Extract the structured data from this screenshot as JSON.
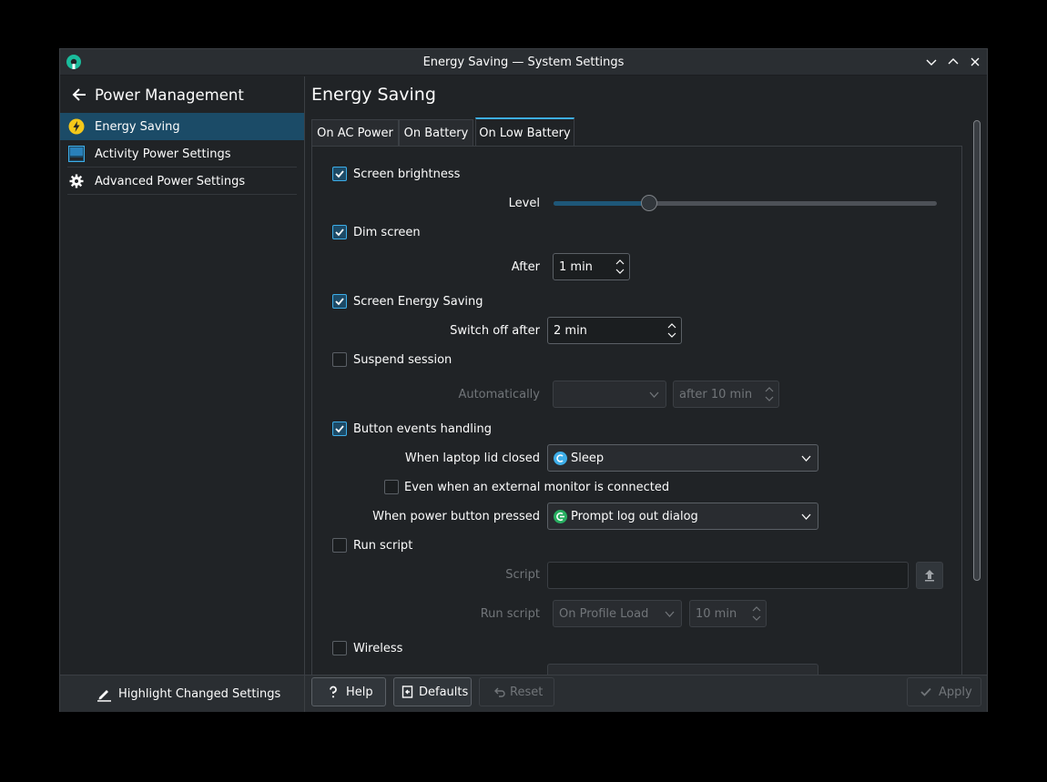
{
  "window": {
    "title": "Energy Saving — System Settings",
    "app_icon": "system-settings-icon",
    "controls": [
      "minimize-icon",
      "maximize-icon",
      "close-icon"
    ]
  },
  "sidebar": {
    "back_icon": "arrow-left-icon",
    "title": "Power Management",
    "items": [
      {
        "label": "Energy Saving",
        "icon": "lightning-icon",
        "active": true
      },
      {
        "label": "Activity Power Settings",
        "icon": "activity-icon",
        "active": false
      },
      {
        "label": "Advanced Power Settings",
        "icon": "gear-icon",
        "active": false
      }
    ],
    "footer": {
      "label": "Highlight Changed Settings",
      "icon": "pencil-icon"
    }
  },
  "main": {
    "title": "Energy Saving",
    "tabs": [
      {
        "label": "On AC Power",
        "active": false
      },
      {
        "label": "On Battery",
        "active": false
      },
      {
        "label": "On Low Battery",
        "active": true
      }
    ]
  },
  "settings": {
    "screen_brightness": {
      "label": "Screen brightness",
      "checked": true,
      "level_label": "Level",
      "level_fraction": 0.25
    },
    "dim_screen": {
      "label": "Dim screen",
      "checked": true,
      "after_label": "After",
      "after_value": "1 min"
    },
    "screen_energy_saving": {
      "label": "Screen Energy Saving",
      "checked": true,
      "switch_off_label": "Switch off after",
      "switch_off_value": "2 min"
    },
    "suspend_session": {
      "label": "Suspend session",
      "checked": false,
      "auto_label": "Automatically",
      "auto_value": "",
      "after_value": "after 10 min"
    },
    "button_events": {
      "label": "Button events handling",
      "checked": true,
      "lid_label": "When laptop lid closed",
      "lid_value": "Sleep",
      "external_monitor_label": "Even when an external monitor is connected",
      "external_monitor_checked": false,
      "power_button_label": "When power button pressed",
      "power_button_value": "Prompt log out dialog"
    },
    "run_script": {
      "label": "Run script",
      "checked": false,
      "script_label": "Script",
      "script_value": "",
      "run_label": "Run script",
      "run_value": "On Profile Load",
      "run_time": "10 min"
    },
    "wireless": {
      "label": "Wireless",
      "checked": false
    }
  },
  "buttons": {
    "help": "Help",
    "defaults": "Defaults",
    "reset": "Reset",
    "apply": "Apply"
  },
  "colors": {
    "accent": "#3daee9",
    "window_bg": "#202326",
    "selection": "#1b4b67"
  }
}
